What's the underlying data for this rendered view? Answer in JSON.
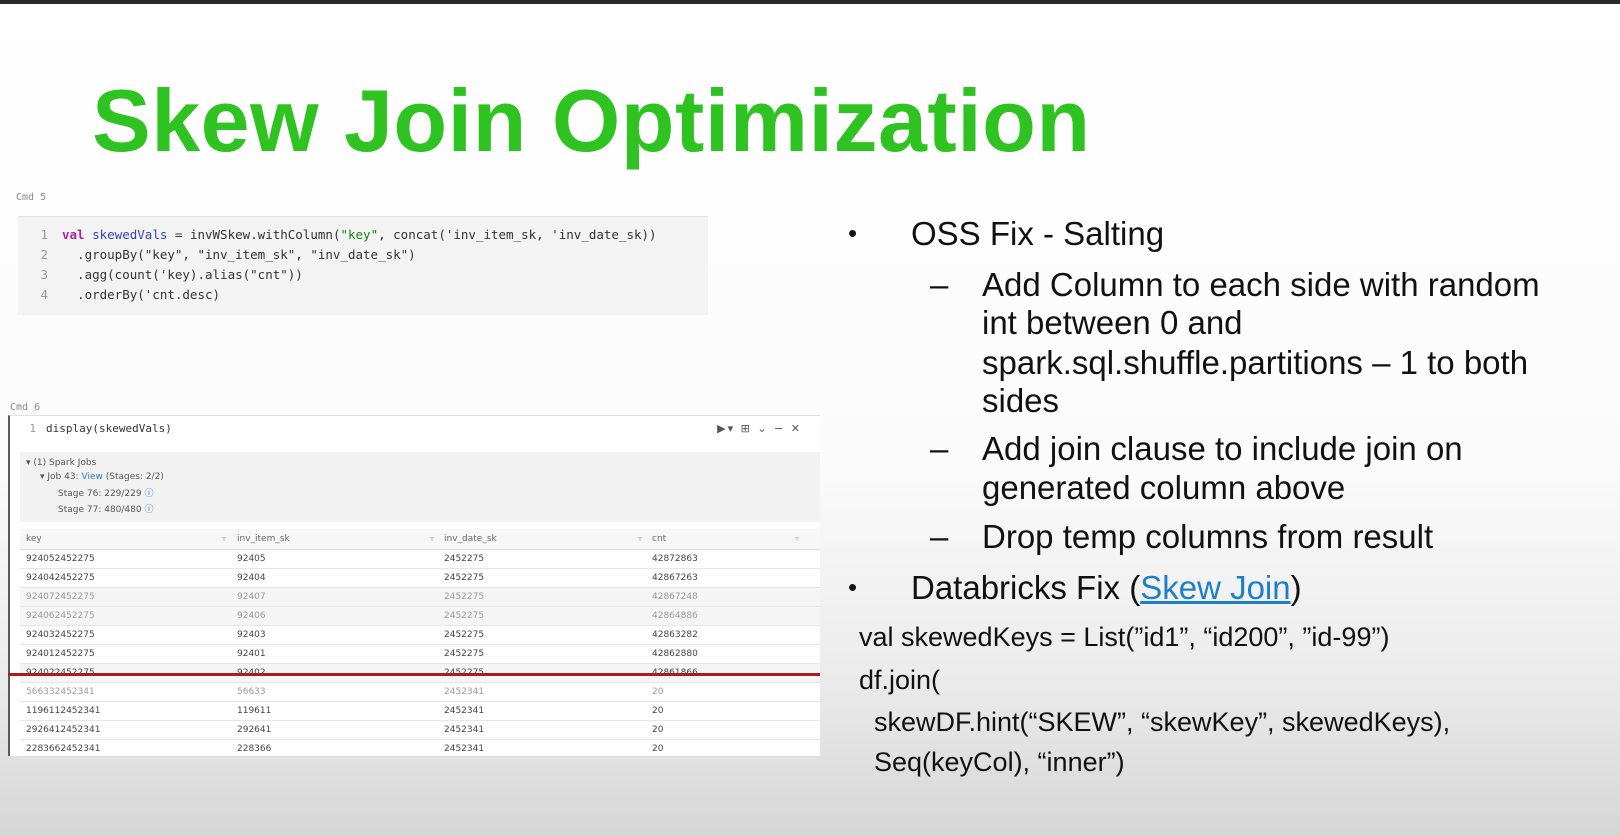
{
  "slide": {
    "title": "Skew Join Optimization"
  },
  "cell1": {
    "label": "Cmd 5",
    "lines": [
      {
        "num": "1",
        "kw": "val",
        "var": "skewedVals",
        "rest1": " = invWSkew.withColumn(",
        "s1": "\"key\"",
        "rest2": ", concat('inv_item_sk, 'inv_date_sk))"
      },
      {
        "num": "2",
        "text": "  .groupBy(\"key\", \"inv_item_sk\", \"inv_date_sk\")"
      },
      {
        "num": "3",
        "text": "  .agg(count('key).alias(\"cnt\"))"
      },
      {
        "num": "4",
        "text": "  .orderBy('cnt.desc)"
      }
    ]
  },
  "cell2": {
    "label": "Cmd 6",
    "line_num": "1",
    "code": "display(skewedVals)",
    "tools": "▶▾ ⊞ ⌄ − ✕",
    "jobs": {
      "header": "▾ (1) Spark Jobs",
      "job": "▾ Job 43:",
      "view": "View",
      "stages_count": "(Stages: 2/2)",
      "stage1": "Stage 76: 229/229",
      "stage2": "Stage 77: 480/480",
      "info_icon": "ⓘ"
    },
    "table": {
      "columns": [
        "key",
        "inv_item_sk",
        "inv_date_sk",
        "cnt"
      ],
      "sort_icon": "▿",
      "rows": [
        [
          "924052452275",
          "92405",
          "2452275",
          "42872863"
        ],
        [
          "924042452275",
          "92404",
          "2452275",
          "42867263"
        ],
        [
          "924072452275",
          "92407",
          "2452275",
          "42867248"
        ],
        [
          "924062452275",
          "92406",
          "2452275",
          "42864886"
        ],
        [
          "924032452275",
          "92403",
          "2452275",
          "42863282"
        ],
        [
          "924012452275",
          "92401",
          "2452275",
          "42862880"
        ],
        [
          "924022452275",
          "92402",
          "2452275",
          "42861866"
        ],
        [
          "566332452341",
          "56633",
          "2452341",
          "20"
        ],
        [
          "1196112452341",
          "119611",
          "2452341",
          "20"
        ],
        [
          "2926412452341",
          "292641",
          "2452341",
          "20"
        ],
        [
          "2283662452341",
          "228366",
          "2452341",
          "20"
        ]
      ]
    }
  },
  "bullets": {
    "oss": "OSS Fix - Salting",
    "sub1_lines": [
      "Add Column to each side with random",
      "int between 0 and",
      "spark.sql.shuffle.partitions – 1 to both",
      "sides"
    ],
    "sub2_lines": [
      "Add join clause to include join on",
      "generated column above"
    ],
    "sub3": "Drop temp columns from result",
    "databricks_prefix": "Databricks Fix (",
    "databricks_link": "Skew Join",
    "databricks_suffix": ")",
    "bullet_glyph": "•",
    "dash_glyph": "–"
  },
  "databricks_code": [
    "val skewedKeys = List(”id1”, “id200”, ”id-99”)",
    "df.join(",
    "  skewDF.hint(“SKEW”, “skewKey”, skewedKeys),",
    "  Seq(keyCol), “inner”)"
  ]
}
